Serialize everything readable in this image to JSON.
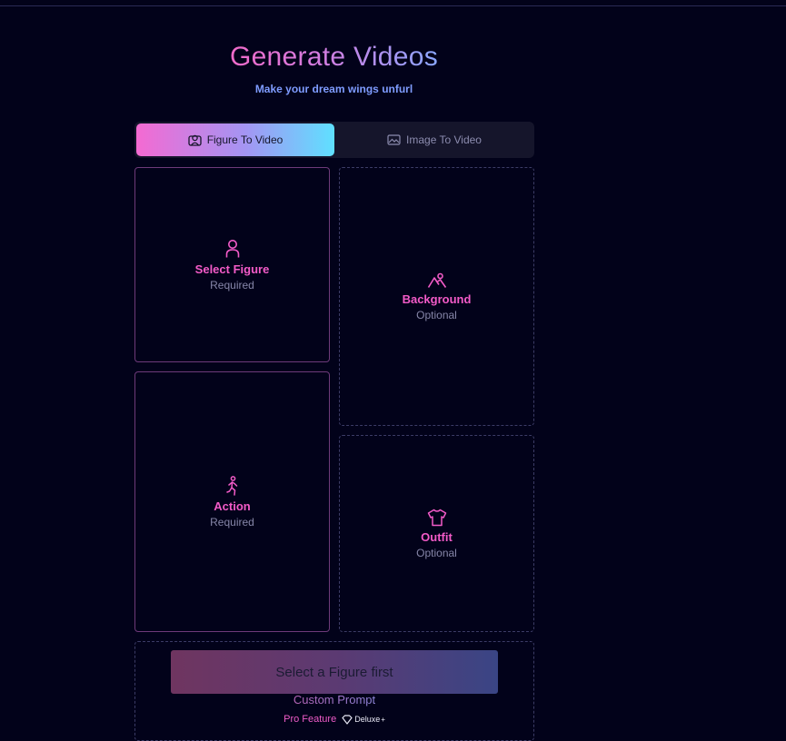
{
  "header": {
    "title": "Generate Videos",
    "subtitle": "Make your dream wings unfurl"
  },
  "tabs": [
    {
      "label": "Figure To Video",
      "active": true,
      "icon": "user-square-icon"
    },
    {
      "label": "Image To Video",
      "active": false,
      "icon": "image-icon"
    }
  ],
  "slots": {
    "figure": {
      "label": "Select Figure",
      "note": "Required",
      "icon": "user-icon"
    },
    "background": {
      "label": "Background",
      "note": "Optional",
      "icon": "mountain-icon"
    },
    "action": {
      "label": "Action",
      "note": "Required",
      "icon": "running-person-icon"
    },
    "outfit": {
      "label": "Outfit",
      "note": "Optional",
      "icon": "tshirt-icon"
    }
  },
  "generate_button": {
    "label": "Select a Figure first"
  },
  "custom_prompt": {
    "label": "Custom Prompt",
    "pro_label": "Pro Feature",
    "badge": "Deluxe",
    "badge_sup": "+"
  },
  "colors": {
    "background": "#02021a",
    "accent_pink": "#f35bc8",
    "accent_cyan": "#5fe0ff",
    "muted_text": "#8686a8"
  }
}
